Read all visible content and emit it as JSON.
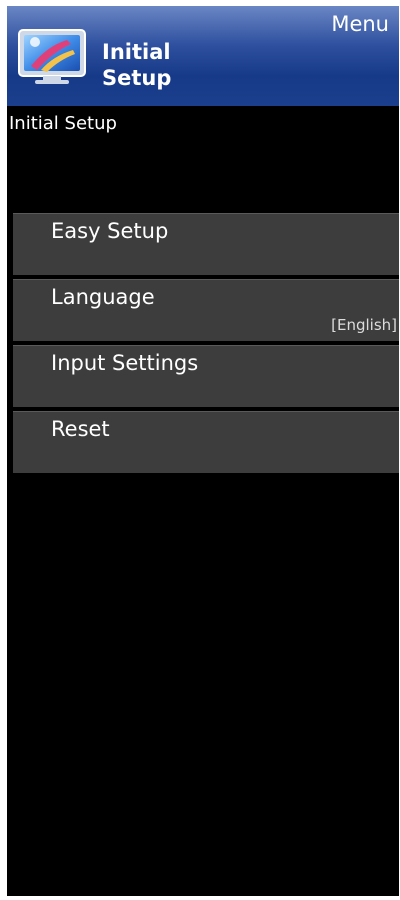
{
  "header": {
    "menu_label": "Menu",
    "title_line1": "Initial",
    "title_line2": "Setup",
    "icon": "tv-setup-icon"
  },
  "breadcrumb": "Initial Setup",
  "menu": {
    "items": [
      {
        "label": "Easy Setup",
        "value": ""
      },
      {
        "label": "Language",
        "value": "[English]"
      },
      {
        "label": "Input Settings",
        "value": ""
      },
      {
        "label": "Reset",
        "value": ""
      }
    ]
  },
  "colors": {
    "header_blue": "#1b3f8c",
    "background": "#000000",
    "item_gray": "#3d3d3d",
    "text": "#ffffff"
  }
}
